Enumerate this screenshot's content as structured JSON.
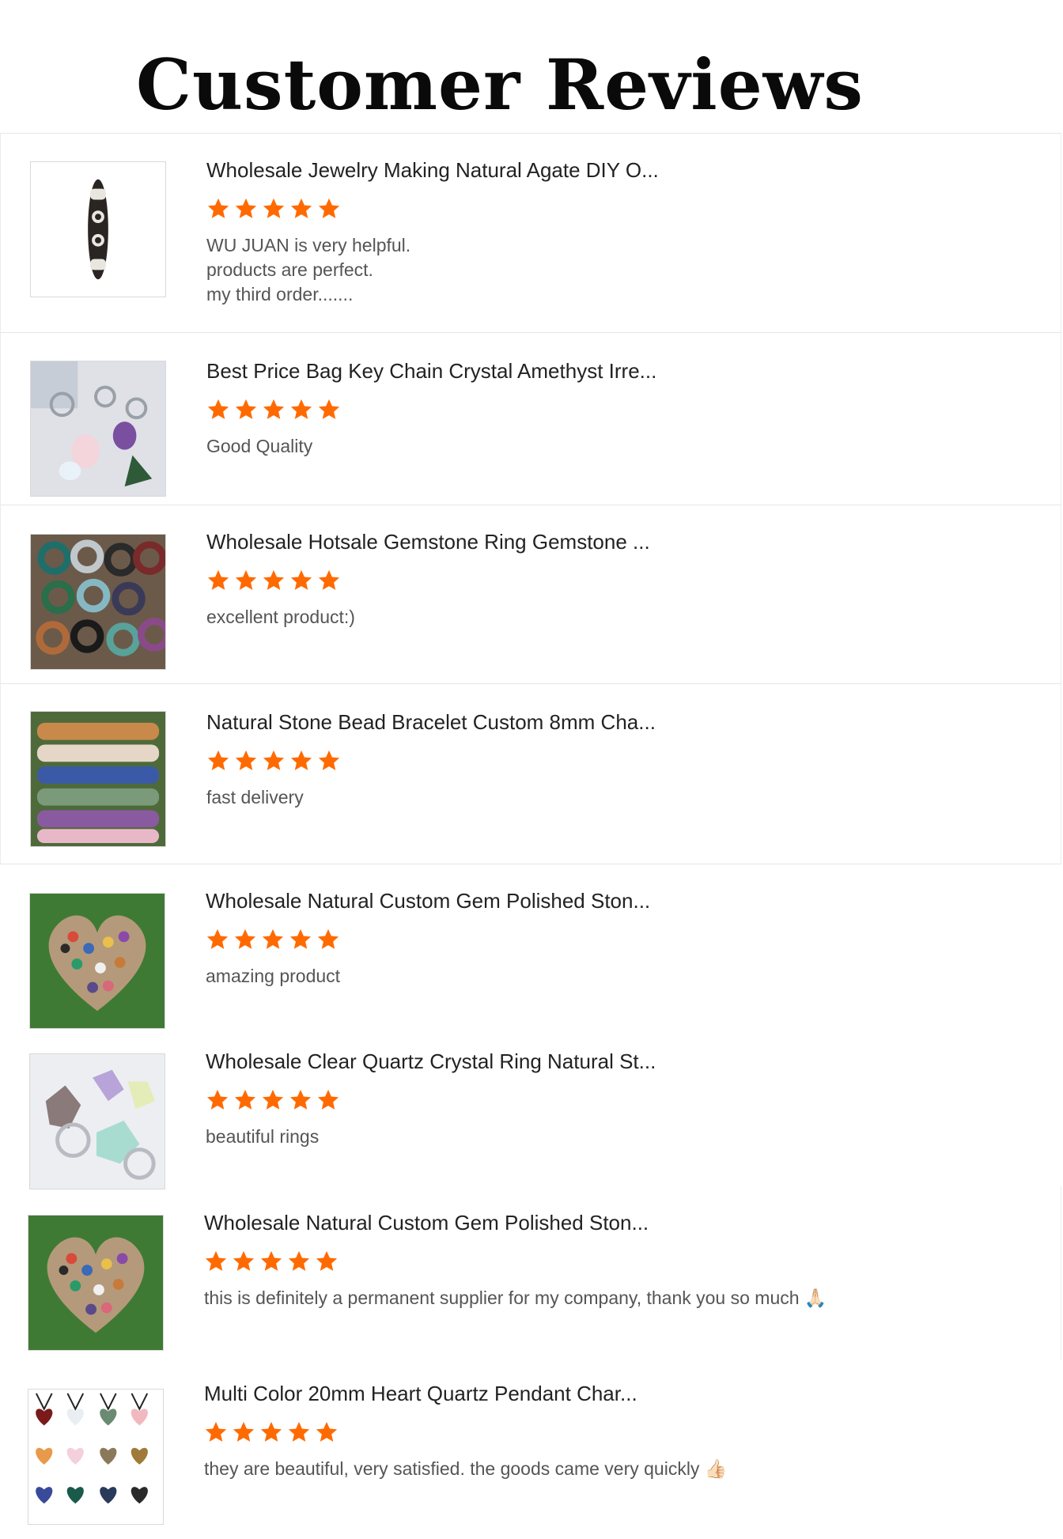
{
  "page": {
    "title": "Customer Reviews"
  },
  "colors": {
    "star": "#ff6a00",
    "title": "#0a0a0a",
    "product_title": "#222222",
    "review_text": "#555555"
  },
  "reviews": [
    {
      "product_title": "Wholesale Jewelry Making Natural Agate DIY O...",
      "rating": 5,
      "text": "WU JUAN is very helpful.\nproducts are perfect.\nmy third order.......",
      "thumbnail_icon": "dzi-bead-image"
    },
    {
      "product_title": "Best Price Bag Key Chain Crystal Amethyst Irre...",
      "rating": 5,
      "text": "Good Quality",
      "thumbnail_icon": "crystal-keychain-image"
    },
    {
      "product_title": "Wholesale Hotsale Gemstone Ring Gemstone ...",
      "rating": 5,
      "text": "excellent product:)",
      "thumbnail_icon": "gemstone-rings-image"
    },
    {
      "product_title": "Natural Stone Bead Bracelet Custom 8mm Cha...",
      "rating": 5,
      "text": "fast delivery",
      "thumbnail_icon": "bead-bracelets-image"
    },
    {
      "product_title": "Wholesale Natural Custom Gem Polished Ston...",
      "rating": 5,
      "text": "amazing product",
      "thumbnail_icon": "heart-stones-image"
    },
    {
      "product_title": "Wholesale Clear Quartz Crystal Ring Natural St...",
      "rating": 5,
      "text": "beautiful rings",
      "thumbnail_icon": "quartz-rings-image"
    },
    {
      "product_title": "Wholesale Natural Custom Gem Polished Ston...",
      "rating": 5,
      "text": "this is definitely a permanent supplier for my company, thank you so much 🙏🏻",
      "thumbnail_icon": "heart-stones-image"
    },
    {
      "product_title": "Multi Color 20mm Heart Quartz Pendant Char...",
      "rating": 5,
      "text": "they are beautiful, very satisfied. the goods came very quickly 👍🏻",
      "thumbnail_icon": "heart-pendants-image"
    }
  ]
}
